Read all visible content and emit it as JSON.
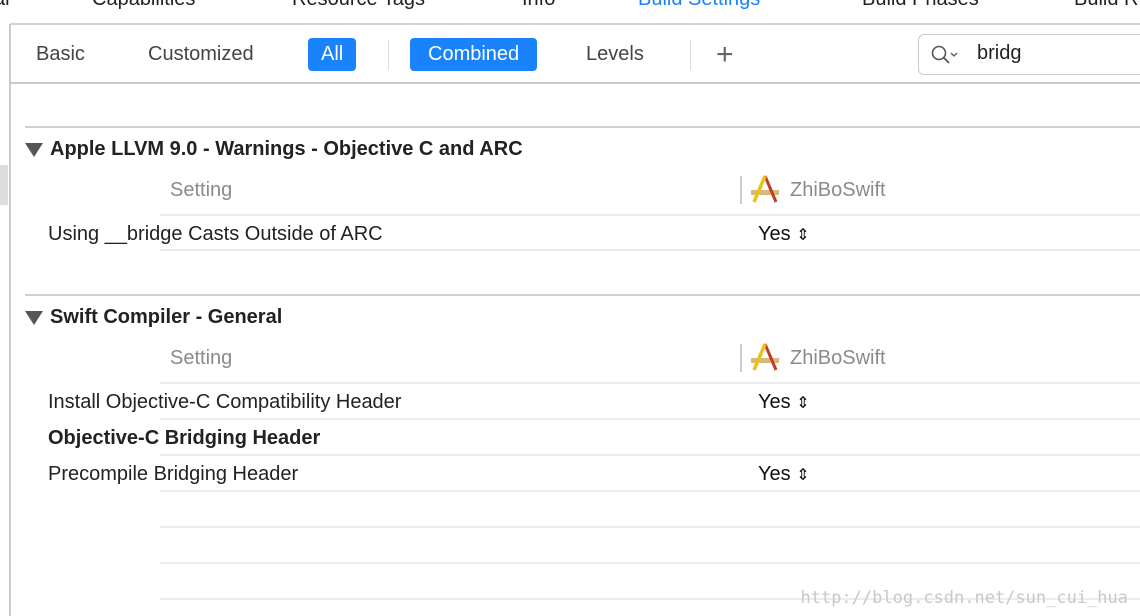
{
  "top_tabs": [
    {
      "label": "al"
    },
    {
      "label": "Capabilities"
    },
    {
      "label": "Resource Tags"
    },
    {
      "label": "Info"
    },
    {
      "label": "Build Settings",
      "active": true
    },
    {
      "label": "Build Phases"
    },
    {
      "label": "Build R"
    }
  ],
  "filter_bar": {
    "basic": "Basic",
    "customized": "Customized",
    "all": "All",
    "combined": "Combined",
    "levels": "Levels",
    "add": "+",
    "search_value": "bridg"
  },
  "colors": {
    "accent": "#1a82fb"
  },
  "sections": [
    {
      "title": "Apple LLVM 9.0 - Warnings - Objective C and ARC",
      "setting_header": "Setting",
      "target": "ZhiBoSwift",
      "rows": [
        {
          "name": "Using __bridge Casts Outside of ARC",
          "value": "Yes",
          "bold": false
        }
      ]
    },
    {
      "title": "Swift Compiler - General",
      "setting_header": "Setting",
      "target": "ZhiBoSwift",
      "rows": [
        {
          "name": "Install Objective-C Compatibility Header",
          "value": "Yes",
          "bold": false
        },
        {
          "name": "Objective-C Bridging Header",
          "value": "",
          "bold": true
        },
        {
          "name": "Precompile Bridging Header",
          "value": "Yes",
          "bold": false
        }
      ]
    }
  ],
  "watermark": "http://blog.csdn.net/sun_cui_hua"
}
